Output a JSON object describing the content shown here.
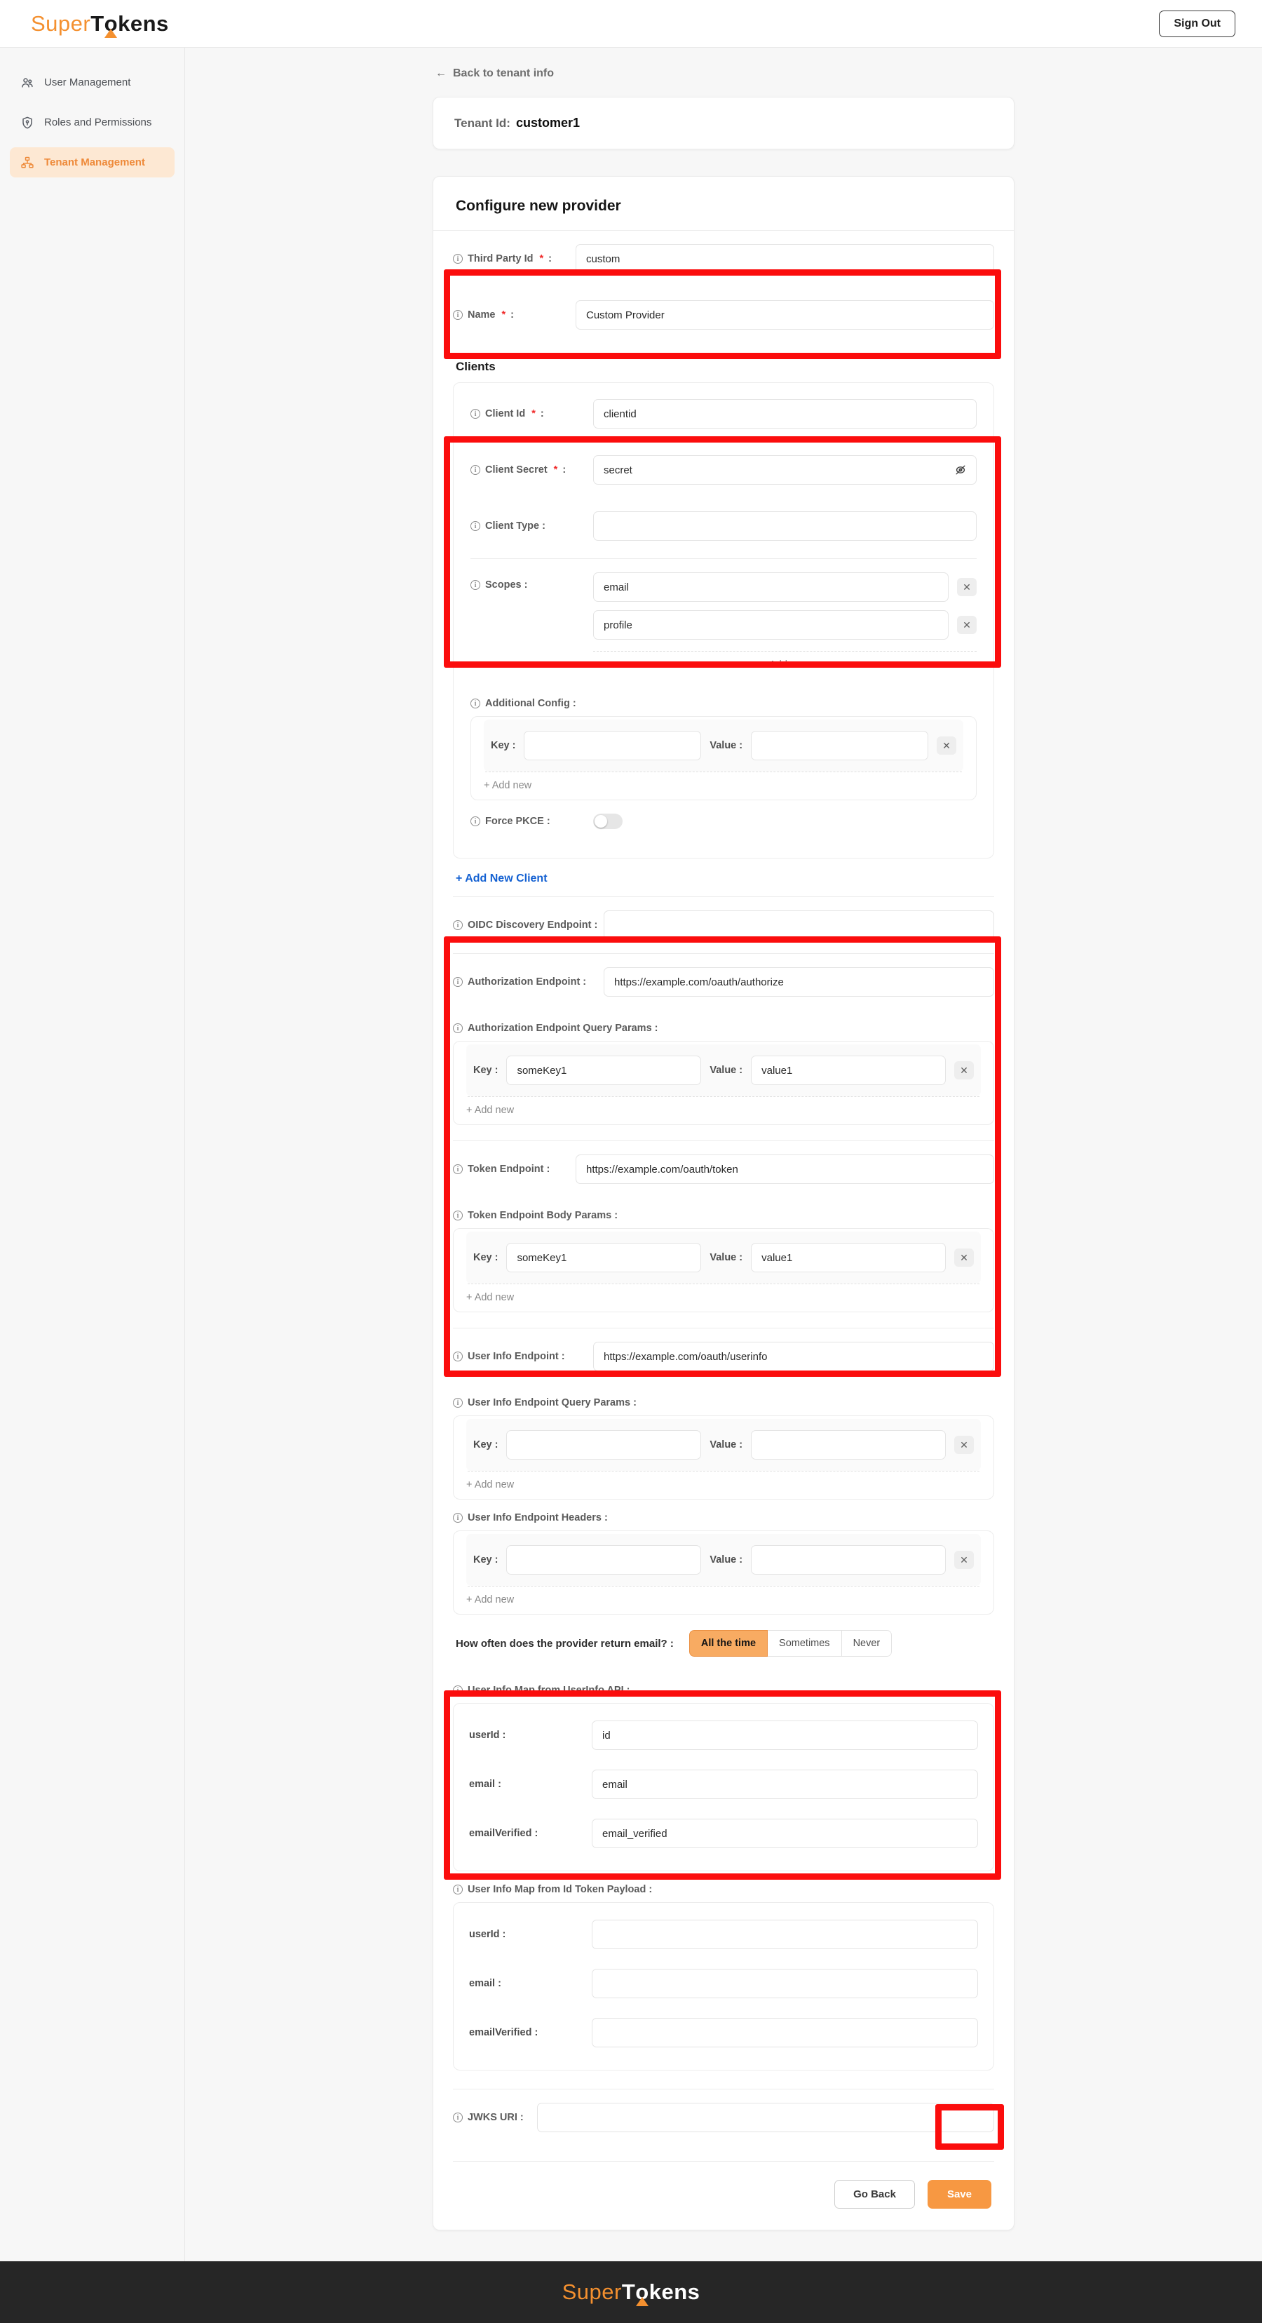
{
  "header": {
    "logo_super": "Super",
    "logo_t": "T",
    "logo_o": "o",
    "logo_kens": "kens",
    "sign_out": "Sign Out"
  },
  "sidebar": {
    "items": [
      {
        "label": "User Management",
        "icon": "users-icon",
        "active": false
      },
      {
        "label": "Roles and Permissions",
        "icon": "shield-key-icon",
        "active": false
      },
      {
        "label": "Tenant Management",
        "icon": "org-hierarchy-icon",
        "active": true
      }
    ]
  },
  "main": {
    "back_link": "Back to tenant info",
    "back_arrow": "←",
    "tenant": {
      "label": "Tenant Id:",
      "value": "customer1"
    },
    "provider_title": "Configure new provider",
    "third_party_id": {
      "label": "Third Party Id",
      "required": "*",
      "colon": ":",
      "value": "custom"
    },
    "name": {
      "label": "Name",
      "required": "*",
      "colon": ":",
      "value": "Custom Provider"
    },
    "clients_heading": "Clients",
    "client": {
      "client_id": {
        "label": "Client Id",
        "required": "*",
        "colon": ":",
        "value": "clientid"
      },
      "client_secret": {
        "label": "Client Secret",
        "required": "*",
        "colon": ":",
        "value": "secret"
      },
      "client_type": {
        "label": "Client Type :",
        "value": ""
      },
      "scopes": {
        "label": "Scopes :",
        "values": [
          "email",
          "profile"
        ],
        "remove": "✕",
        "add_new": "+ Add new"
      },
      "additional_config": {
        "label": "Additional Config :",
        "key_label": "Key :",
        "value_label": "Value :",
        "key": "",
        "value": "",
        "remove": "✕",
        "add_new": "+ Add new"
      },
      "force_pkce": {
        "label": "Force PKCE :",
        "on": false
      }
    },
    "add_new_client": "+ Add New Client",
    "oidc_discovery_endpoint": {
      "label": "OIDC Discovery Endpoint :",
      "value": ""
    },
    "authorization_endpoint": {
      "label": "Authorization Endpoint :",
      "value": "https://example.com/oauth/authorize"
    },
    "authorization_query_params": {
      "label": "Authorization Endpoint Query Params :",
      "key_label": "Key :",
      "value_label": "Value :",
      "key": "someKey1",
      "value": "value1",
      "remove": "✕",
      "add_new": "+ Add new"
    },
    "token_endpoint": {
      "label": "Token Endpoint :",
      "value": "https://example.com/oauth/token"
    },
    "token_body_params": {
      "label": "Token Endpoint Body Params :",
      "key_label": "Key :",
      "value_label": "Value :",
      "key": "someKey1",
      "value": "value1",
      "remove": "✕",
      "add_new": "+ Add new"
    },
    "user_info_endpoint": {
      "label": "User Info Endpoint :",
      "value": "https://example.com/oauth/userinfo"
    },
    "user_info_query_params": {
      "label": "User Info Endpoint Query Params :",
      "key_label": "Key :",
      "value_label": "Value :",
      "key": "",
      "value": "",
      "remove": "✕",
      "add_new": "+ Add new"
    },
    "user_info_headers": {
      "label": "User Info Endpoint Headers :",
      "key_label": "Key :",
      "value_label": "Value :",
      "key": "",
      "value": "",
      "remove": "✕",
      "add_new": "+ Add new"
    },
    "email_frequency": {
      "question": "How often does the provider return email? :",
      "options": [
        "All the time",
        "Sometimes",
        "Never"
      ],
      "selected": "All the time"
    },
    "user_info_map_userinfo_api": {
      "label": "User Info Map from UserInfo API :",
      "rows": [
        {
          "label": "userId :",
          "value": "id"
        },
        {
          "label": "email :",
          "value": "email"
        },
        {
          "label": "emailVerified :",
          "value": "email_verified"
        }
      ]
    },
    "user_info_map_id_token": {
      "label": "User Info Map from Id Token Payload :",
      "rows": [
        {
          "label": "userId :",
          "value": ""
        },
        {
          "label": "email :",
          "value": ""
        },
        {
          "label": "emailVerified :",
          "value": ""
        }
      ]
    },
    "jwks_uri": {
      "label": "JWKS URI :",
      "value": ""
    },
    "buttons": {
      "go_back": "Go Back",
      "save": "Save"
    }
  },
  "footer": {
    "logo_super": "Super",
    "logo_t": "T",
    "logo_o": "o",
    "logo_kens": "kens"
  },
  "colors": {
    "accent": "#f4902f",
    "annotation": "#fb0d0d",
    "link": "#1461d2",
    "required": "#f02c2c"
  }
}
